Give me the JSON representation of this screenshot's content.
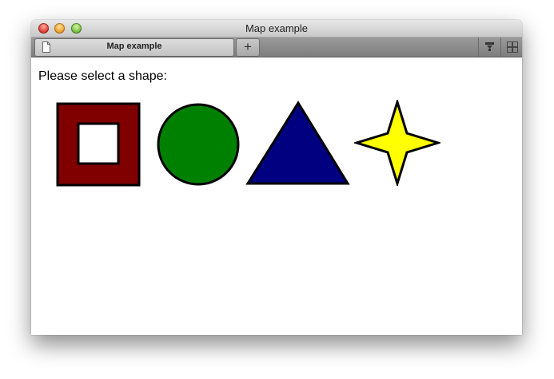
{
  "window": {
    "title": "Map example"
  },
  "tab": {
    "label": "Map example",
    "new_tab_label": "+"
  },
  "toolbar_icons": [
    "downloads-icon",
    "tab-overview-icon"
  ],
  "page": {
    "prompt": "Please select a shape:"
  },
  "shapes": [
    {
      "name": "square",
      "fill": "#800000",
      "inner_fill": "#ffffff"
    },
    {
      "name": "circle",
      "fill": "#008000"
    },
    {
      "name": "triangle",
      "fill": "#000080"
    },
    {
      "name": "star",
      "fill": "#ffff00"
    }
  ],
  "colors": {
    "outline": "#000000",
    "page_background": "#ffffff"
  }
}
